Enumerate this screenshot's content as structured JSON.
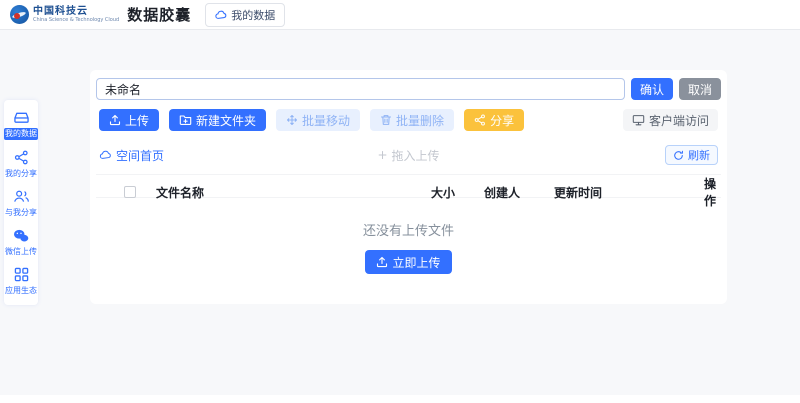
{
  "header": {
    "logo_text": "中国科技云",
    "logo_subtext": "China Science & Technology Cloud",
    "app_title": "数据胶囊",
    "my_data_button": "我的数据"
  },
  "rename_bar": {
    "input_value": "未命名",
    "confirm_label": "确认",
    "cancel_label": "取消"
  },
  "toolbar": {
    "upload_label": "上传",
    "new_folder_label": "新建文件夹",
    "batch_move_label": "批量移动",
    "batch_delete_label": "批量删除",
    "share_label": "分享",
    "client_access_label": "客户端访问"
  },
  "breadcrumb_bar": {
    "home_label": "空间首页",
    "drop_hint_plus": "+",
    "drop_hint": "拖入上传",
    "refresh_label": "刷新"
  },
  "table": {
    "columns": {
      "name": "文件名称",
      "size": "大小",
      "creator": "创建人",
      "updated": "更新时间",
      "actions": "操作"
    },
    "rows": []
  },
  "empty_state": {
    "message": "还没有上传文件",
    "upload_now_label": "立即上传"
  },
  "sidebar": {
    "items": [
      {
        "label": "我的数据",
        "icon": "cloud-drive-icon",
        "selected": true
      },
      {
        "label": "我的分享",
        "icon": "share-icon",
        "selected": false
      },
      {
        "label": "与我分享",
        "icon": "people-icon",
        "selected": false
      },
      {
        "label": "微信上传",
        "icon": "wechat-icon",
        "selected": false
      },
      {
        "label": "应用生态",
        "icon": "apps-grid-icon",
        "selected": false
      }
    ]
  },
  "colors": {
    "primary_blue": "#3370ff",
    "cancel_gray": "#8a919c",
    "share_yellow": "#fbc23c",
    "soft_blue_bg": "#e8f0fe",
    "soft_blue_text": "#8fb3f5",
    "page_bg": "#f7f8fa"
  }
}
